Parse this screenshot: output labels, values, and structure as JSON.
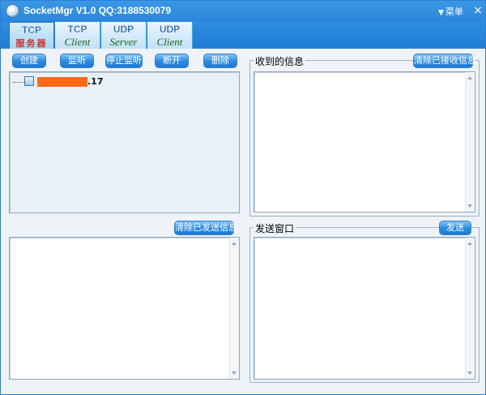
{
  "window": {
    "title": "SocketMgr V1.0  QQ:3188530079",
    "menu_label": "菜单",
    "menu_caret": "▼",
    "close_glyph": "×"
  },
  "tabs": [
    {
      "top": "TCP",
      "bottom": "服务器",
      "active": true
    },
    {
      "top": "TCP",
      "bottom": "Client",
      "active": false
    },
    {
      "top": "UDP",
      "bottom": "Server",
      "active": false
    },
    {
      "top": "UDP",
      "bottom": "Client",
      "active": false
    }
  ],
  "toolbar": {
    "create": "创建",
    "listen": "监听",
    "stop_listen": "停止监听",
    "disconnect": "断开",
    "delete": "删除"
  },
  "tree": {
    "node_suffix": ".17"
  },
  "received": {
    "label": "收到的信息",
    "clear_button": "清除已接收信息"
  },
  "sent": {
    "clear_button": "清除已发送信息"
  },
  "send_window": {
    "label": "发送窗口",
    "send_button": "发送"
  },
  "colors": {
    "title_bar": "#2a86db",
    "button_blue": "#2b8ae0",
    "redaction": "#ff6a17"
  }
}
